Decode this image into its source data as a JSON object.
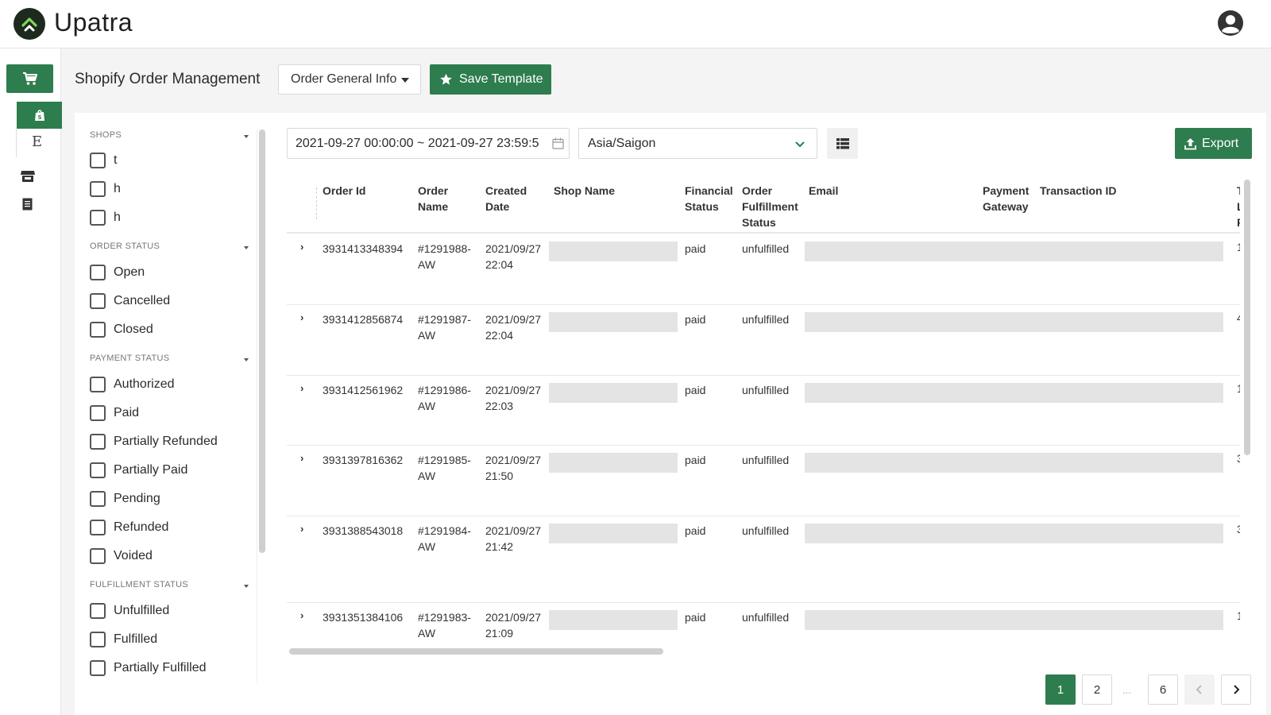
{
  "app": {
    "name": "Upatra"
  },
  "header": {
    "title": "Shopify Order Management",
    "template_select": "Order General Info",
    "save_template": "Save Template"
  },
  "filters": {
    "shops": {
      "heading": "SHOPS",
      "items": [
        "t",
        "h",
        "h"
      ]
    },
    "order_status": {
      "heading": "ORDER STATUS",
      "items": [
        "Open",
        "Cancelled",
        "Closed"
      ]
    },
    "payment_status": {
      "heading": "PAYMENT STATUS",
      "items": [
        "Authorized",
        "Paid",
        "Partially Refunded",
        "Partially Paid",
        "Pending",
        "Refunded",
        "Voided"
      ]
    },
    "fulfillment_status": {
      "heading": "FULFILLMENT STATUS",
      "items": [
        "Unfulfilled",
        "Fulfilled",
        "Partially Fulfilled"
      ]
    }
  },
  "toolbar": {
    "date_range": "2021-09-27 00:00:00 ~ 2021-09-27 23:59:5",
    "timezone": "Asia/Saigon",
    "export": "Export"
  },
  "table": {
    "columns": {
      "order_id": "Order Id",
      "order_name_1": "Order",
      "order_name_2": "Name",
      "created_1": "Created",
      "created_2": "Date",
      "shop_name": "Shop Name",
      "financial_1": "Financial",
      "financial_2": "Status",
      "fulfill_1": "Order",
      "fulfill_2": "Fulfillment",
      "fulfill_3": "Status",
      "email": "Email",
      "gateway_1": "Payment",
      "gateway_2": "Gateway",
      "transaction": "Transaction ID",
      "cut_1": "T",
      "cut_2": "L",
      "cut_3": "F"
    },
    "rows": [
      {
        "id": "3931413348394",
        "name_1": "#1291988-",
        "name_2": "AW",
        "date": "2021/09/27",
        "time": "22:04",
        "financial": "paid",
        "fulfillment": "unfulfilled",
        "cut": "1"
      },
      {
        "id": "3931412856874",
        "name_1": "#1291987-",
        "name_2": "AW",
        "date": "2021/09/27",
        "time": "22:04",
        "financial": "paid",
        "fulfillment": "unfulfilled",
        "cut": "4"
      },
      {
        "id": "3931412561962",
        "name_1": "#1291986-",
        "name_2": "AW",
        "date": "2021/09/27",
        "time": "22:03",
        "financial": "paid",
        "fulfillment": "unfulfilled",
        "cut": "1"
      },
      {
        "id": "3931397816362",
        "name_1": "#1291985-",
        "name_2": "AW",
        "date": "2021/09/27",
        "time": "21:50",
        "financial": "paid",
        "fulfillment": "unfulfilled",
        "cut": "3"
      },
      {
        "id": "3931388543018",
        "name_1": "#1291984-",
        "name_2": "AW",
        "date": "2021/09/27",
        "time": "21:42",
        "financial": "paid",
        "fulfillment": "unfulfilled",
        "cut": "3"
      },
      {
        "id": "3931351384106",
        "name_1": "#1291983-",
        "name_2": "AW",
        "date": "2021/09/27",
        "time": "21:09",
        "financial": "paid",
        "fulfillment": "unfulfilled",
        "cut": "1"
      }
    ]
  },
  "pagination": {
    "pages": [
      "1",
      "2",
      "6"
    ],
    "ellipsis": "...",
    "current": "1"
  },
  "colors": {
    "primary": "#2e7d4f",
    "background": "#f4f4f4",
    "redacted": "#e4e4e4"
  },
  "icons": [
    "logo-icon",
    "user-avatar-icon",
    "cart-icon",
    "shopify-bag-icon",
    "etsy-icon",
    "store-icon",
    "document-icon",
    "caret-down-icon",
    "star-icon",
    "calendar-icon",
    "chevron-down-icon",
    "list-view-icon",
    "upload-icon",
    "chevron-right-icon",
    "chevron-left-icon"
  ]
}
